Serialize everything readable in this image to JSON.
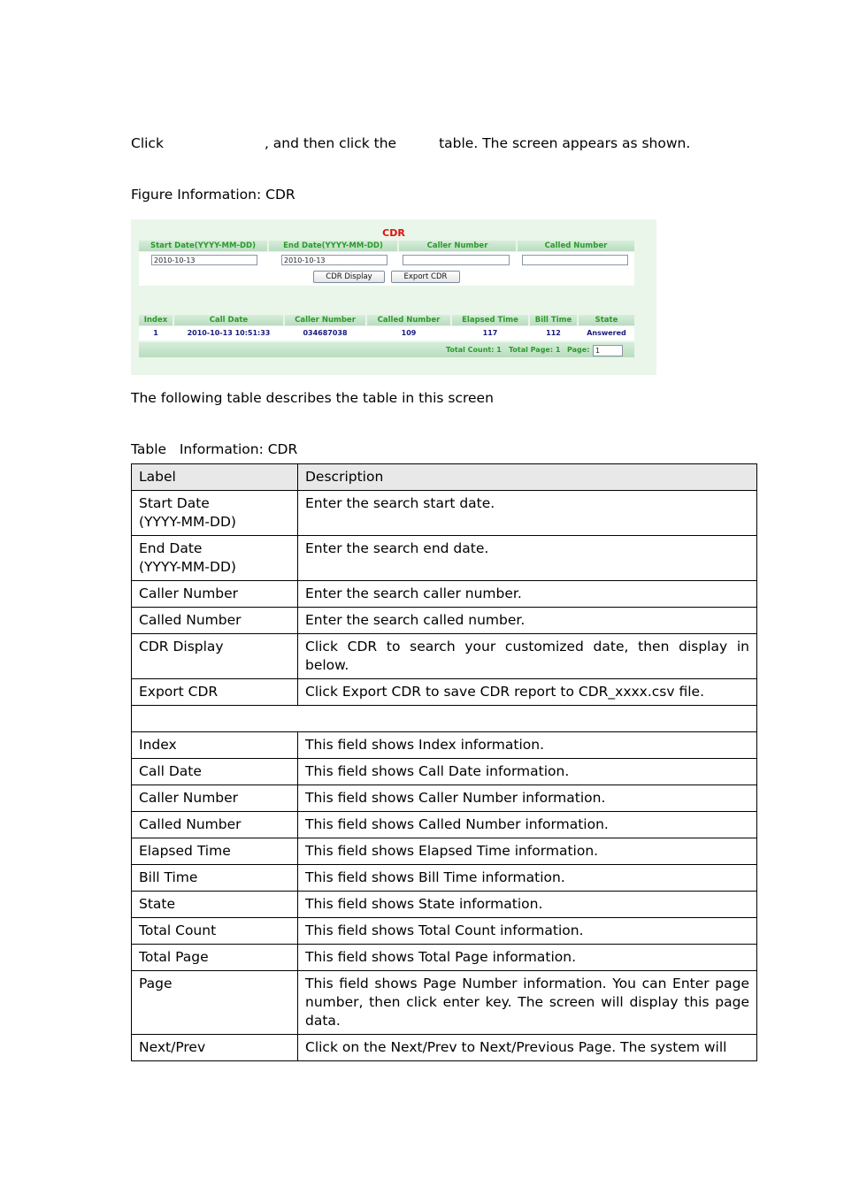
{
  "intro": {
    "part1": "Click",
    "part2": ", and then click the",
    "part3": "table. The screen appears as shown."
  },
  "figure_caption": "Figure Information: CDR",
  "cdr_screen": {
    "title": "CDR",
    "search_headers": [
      "Start Date(YYYY-MM-DD)",
      "End Date(YYYY-MM-DD)",
      "Caller Number",
      "Called Number"
    ],
    "search_values": {
      "start_date": "2010-10-13",
      "end_date": "2010-10-13",
      "caller_number": "",
      "called_number": ""
    },
    "buttons": {
      "cdr_display": "CDR Display",
      "export_cdr": "Export CDR"
    },
    "result_headers": [
      "Index",
      "Call Date",
      "Caller Number",
      "Called Number",
      "Elapsed Time",
      "Bill Time",
      "State"
    ],
    "result_rows": [
      [
        "1",
        "2010-10-13 10:51:33",
        "034687038",
        "109",
        "117",
        "112",
        "Answered"
      ]
    ],
    "footer": {
      "total_count_label": "Total Count:",
      "total_count": "1",
      "total_page_label": "Total Page:",
      "total_page": "1",
      "page_label": "Page:",
      "page_value": "1"
    },
    "colors": {
      "panel_bg": "#eaf6ea",
      "header_text": "#2a9a2a",
      "title_red": "#e01010",
      "cell_text": "#1a1a7a"
    }
  },
  "following_text": "The following table describes the table in this screen",
  "table_caption": "Table   Information: CDR",
  "desc_table": {
    "headers": [
      "Label",
      "Description"
    ],
    "rows": [
      {
        "label": [
          "Start Date",
          "(YYYY-MM-DD)"
        ],
        "desc": "Enter the search start date."
      },
      {
        "label": [
          "End Date",
          "(YYYY-MM-DD)"
        ],
        "desc": "Enter the search end date."
      },
      {
        "label": [
          "Caller Number"
        ],
        "desc": "Enter the search caller number."
      },
      {
        "label": [
          "Called Number"
        ],
        "desc": "Enter the search called number."
      },
      {
        "label": [
          "CDR Display"
        ],
        "desc": "Click CDR to search your customized date, then display in below."
      },
      {
        "label": [
          "Export CDR"
        ],
        "desc": "Click Export CDR to save CDR report to CDR_xxxx.csv file."
      },
      {
        "blank": true
      },
      {
        "label": [
          "Index"
        ],
        "desc": "This field shows Index information."
      },
      {
        "label": [
          "Call Date"
        ],
        "desc": "This field shows Call Date information."
      },
      {
        "label": [
          "Caller Number"
        ],
        "desc": "This field shows Caller Number information."
      },
      {
        "label": [
          "Called Number"
        ],
        "desc": "This field shows Called Number information."
      },
      {
        "label": [
          "Elapsed Time"
        ],
        "desc": "This field shows Elapsed Time information."
      },
      {
        "label": [
          "Bill Time"
        ],
        "desc": "This field shows Bill Time information."
      },
      {
        "label": [
          "State"
        ],
        "desc": "This field shows State information."
      },
      {
        "label": [
          "Total Count"
        ],
        "desc": "This field shows Total Count information."
      },
      {
        "label": [
          "Total Page"
        ],
        "desc": "This field shows Total Page information."
      },
      {
        "label": [
          "Page"
        ],
        "desc": "This field shows Page Number information. You can Enter page number, then click enter key. The screen will display this page data."
      },
      {
        "label": [
          "Next/Prev"
        ],
        "desc": "Click on the Next/Prev to Next/Previous Page. The system will"
      }
    ]
  }
}
